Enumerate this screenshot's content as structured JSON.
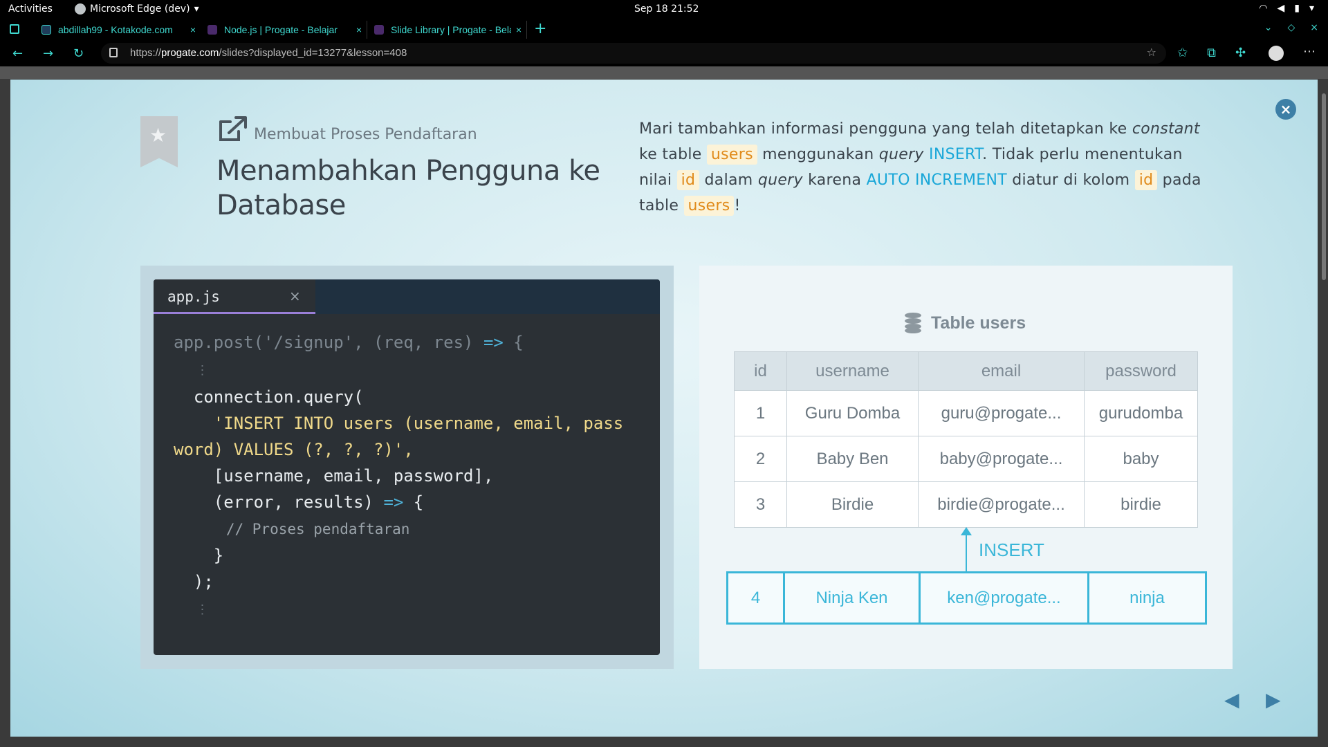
{
  "system_bar": {
    "activities": "Activities",
    "app": "Microsoft Edge (dev)",
    "clock": "Sep 18  21:52"
  },
  "tabs": [
    {
      "label": "abdillah99 - Kotakode.com",
      "favicon_color": "#1f3c5a"
    },
    {
      "label": "Node.js | Progate - Belajar",
      "favicon_color": "#4a2a6b"
    },
    {
      "label": "Slide Library | Progate - Belajar",
      "favicon_color": "#4a2a6b",
      "active": true
    }
  ],
  "address": {
    "prefix": "https://",
    "host": "progate.com",
    "path": "/slides?displayed_id=13277&lesson=408"
  },
  "slide": {
    "subheading": "Membuat Proses Pendaftaran",
    "heading": "Menambahkan Pengguna ke Database",
    "description": {
      "p1": "Mari tambahkan informasi pengguna yang telah ditetapkan ke ",
      "p1_italic": "constant",
      "p2": " ke table ",
      "hl_users": "users",
      "p3": " menggunakan ",
      "p3_italic": "query",
      "kw_insert": "INSERT",
      "p4": ". Tidak perlu menentukan nilai ",
      "hl_id": "id",
      "p5": " dalam ",
      "p5_italic": "query",
      "p6": " karena ",
      "kw_auto": "AUTO INCREMENT",
      "p7": " diatur di kolom ",
      "p8": " pada table ",
      "p9": "!"
    },
    "editor": {
      "filename": "app.js",
      "close": "×",
      "lines": {
        "l1": "app.post('/signup', (req, res) ",
        "l1_arrow": "=>",
        "l1_end": " {",
        "l3": "  connection.query(",
        "l4": "    'INSERT INTO users (username, email, pass",
        "l5": "word) VALUES (?, ?, ?)',",
        "l6": "    [username, email, password],",
        "l7": "    (error, results) ",
        "l7_arrow": "=>",
        "l7_end": " {",
        "l8": "      // Proses pendaftaran",
        "l9": "    }",
        "l10": "  );"
      }
    },
    "table": {
      "title": "Table users",
      "headers": [
        "id",
        "username",
        "email",
        "password"
      ],
      "rows": [
        [
          "1",
          "Guru Domba",
          "guru@progate...",
          "gurudomba"
        ],
        [
          "2",
          "Baby Ben",
          "baby@progate...",
          "baby"
        ],
        [
          "3",
          "Birdie",
          "birdie@progate...",
          "birdie"
        ]
      ],
      "insert_label": "INSERT",
      "new_row": [
        "4",
        "Ninja Ken",
        "ken@progate...",
        "ninja"
      ]
    }
  },
  "colors": {
    "accent": "#3ab6d8",
    "highlight_text": "#e08a1a",
    "highlight_bg": "#fcf3d8",
    "editor_bg": "#2b3035"
  },
  "icons": [
    "star-icon",
    "external-link-icon",
    "close-circle-icon",
    "database-icon",
    "prev-arrow-icon",
    "next-arrow-icon"
  ]
}
